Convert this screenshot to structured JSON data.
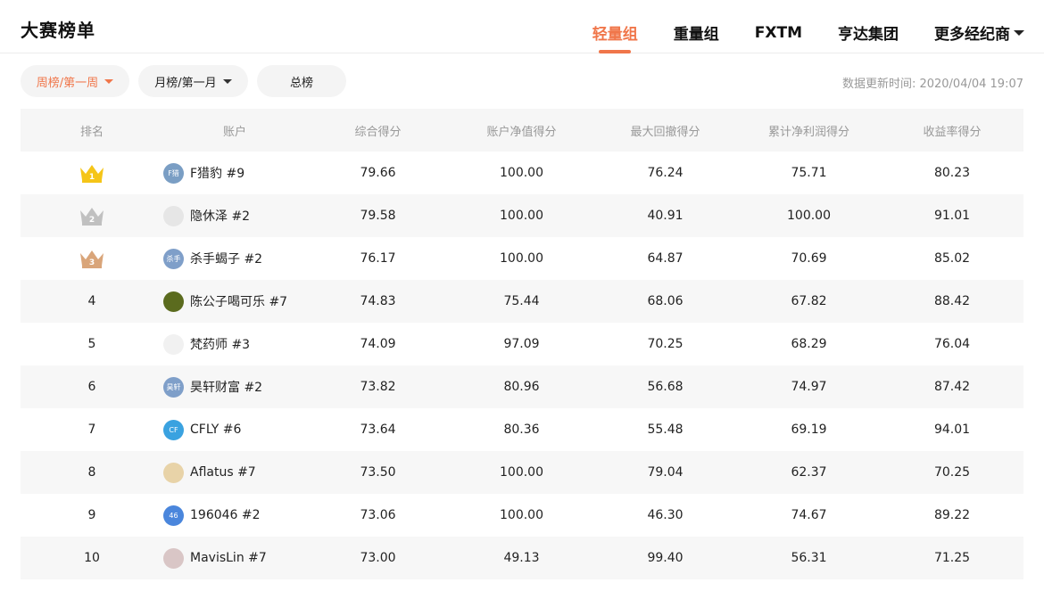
{
  "header": {
    "title": "大赛榜单",
    "tabs": [
      {
        "label": "轻量组",
        "active": true
      },
      {
        "label": "重量组",
        "active": false
      },
      {
        "label": "FXTM",
        "active": false
      },
      {
        "label": "亨达集团",
        "active": false
      },
      {
        "label": "更多经纪商",
        "active": false,
        "dropdown": true
      }
    ]
  },
  "filters": {
    "week": "周榜/第一周",
    "month": "月榜/第一月",
    "total": "总榜",
    "update_time": "数据更新时间: 2020/04/04 19:07"
  },
  "colors": {
    "accent": "#f0764a",
    "gold": "#f5c518",
    "silver": "#c0c0c0",
    "bronze": "#d9a57a"
  },
  "table": {
    "headers": [
      "排名",
      "账户",
      "综合得分",
      "账户净值得分",
      "最大回撤得分",
      "累计净利润得分",
      "收益率得分"
    ],
    "rows": [
      {
        "rank": "1",
        "medal": "gold-crown-icon",
        "avatar_text": "F猎",
        "avatar_color": "#7a9ec4",
        "account": "F猎豹 #9",
        "score": "79.66",
        "nav": "100.00",
        "dd": "76.24",
        "pnl": "75.71",
        "ret": "80.23"
      },
      {
        "rank": "2",
        "medal": "silver-crown-icon",
        "avatar_text": "",
        "avatar_color": "#e6e6e6",
        "account": "隐休泽 #2",
        "score": "79.58",
        "nav": "100.00",
        "dd": "40.91",
        "pnl": "100.00",
        "ret": "91.01"
      },
      {
        "rank": "3",
        "medal": "bronze-crown-icon",
        "avatar_text": "杀手",
        "avatar_color": "#7f9fc9",
        "account": "杀手蝎子 #2",
        "score": "76.17",
        "nav": "100.00",
        "dd": "64.87",
        "pnl": "70.69",
        "ret": "85.02"
      },
      {
        "rank": "4",
        "medal": "",
        "avatar_text": "",
        "avatar_color": "#5b6b1e",
        "account": "陈公子喝可乐 #7",
        "score": "74.83",
        "nav": "75.44",
        "dd": "68.06",
        "pnl": "67.82",
        "ret": "88.42"
      },
      {
        "rank": "5",
        "medal": "",
        "avatar_text": "",
        "avatar_color": "#f1f1f1",
        "account": "梵药师 #3",
        "score": "74.09",
        "nav": "97.09",
        "dd": "70.25",
        "pnl": "68.29",
        "ret": "76.04"
      },
      {
        "rank": "6",
        "medal": "",
        "avatar_text": "昊轩",
        "avatar_color": "#7f9fc9",
        "account": "昊轩财富 #2",
        "score": "73.82",
        "nav": "80.96",
        "dd": "56.68",
        "pnl": "74.97",
        "ret": "87.42"
      },
      {
        "rank": "7",
        "medal": "",
        "avatar_text": "CF",
        "avatar_color": "#3aa2e0",
        "account": "CFLY #6",
        "score": "73.64",
        "nav": "80.36",
        "dd": "55.48",
        "pnl": "69.19",
        "ret": "94.01"
      },
      {
        "rank": "8",
        "medal": "",
        "avatar_text": "",
        "avatar_color": "#e8d3a8",
        "account": "Aflatus #7",
        "score": "73.50",
        "nav": "100.00",
        "dd": "79.04",
        "pnl": "62.37",
        "ret": "70.25"
      },
      {
        "rank": "9",
        "medal": "",
        "avatar_text": "46",
        "avatar_color": "#4a86dc",
        "account": "196046 #2",
        "score": "73.06",
        "nav": "100.00",
        "dd": "46.30",
        "pnl": "74.67",
        "ret": "89.22"
      },
      {
        "rank": "10",
        "medal": "",
        "avatar_text": "",
        "avatar_color": "#d9c6c6",
        "account": "MavisLin #7",
        "score": "73.00",
        "nav": "49.13",
        "dd": "99.40",
        "pnl": "56.31",
        "ret": "71.25"
      }
    ]
  }
}
